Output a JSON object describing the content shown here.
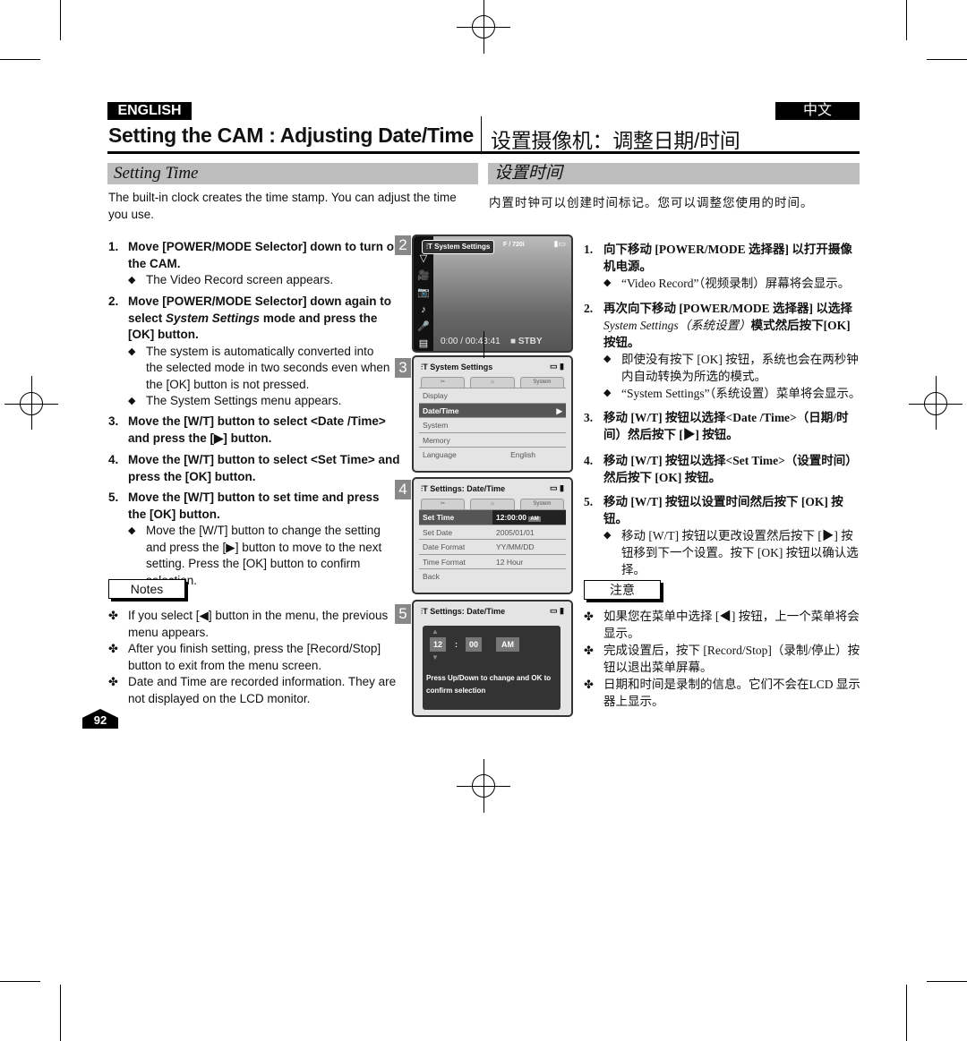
{
  "header": {
    "lang_en": "ENGLISH",
    "lang_cn": "中文",
    "title_en": "Setting the CAM : Adjusting Date/Time",
    "title_cn": "设置摄像机：调整日期/时间"
  },
  "section": {
    "title_en": "Setting Time",
    "title_cn": "设置时间"
  },
  "intro": {
    "en": "The built-in clock creates the time stamp. You can adjust the time you use.",
    "cn": "内置时钟可以创建时间标记。您可以调整您使用的时间。"
  },
  "steps_en": [
    {
      "num": "1.",
      "text": "Move [POWER/MODE Selector] down to turn on the CAM.",
      "bullets": [
        "The Video Record screen appears."
      ]
    },
    {
      "num": "2.",
      "text_a": "Move [POWER/MODE Selector] down again to select ",
      "text_i": "System Settings",
      "text_b": " mode and press the [OK] button.",
      "bullets": [
        "The system is automatically converted into the selected mode in two seconds even when the [OK] button is not pressed.",
        "The System Settings menu appears."
      ]
    },
    {
      "num": "3.",
      "text": "Move the [W/T] button to select <Date /Time> and press the [▶] button."
    },
    {
      "num": "4.",
      "text": "Move the [W/T] button to select <Set Time> and press the [OK] button."
    },
    {
      "num": "5.",
      "text": "Move the [W/T] button to set time and press the [OK] button.",
      "bullets": [
        "Move the [W/T] button to change the setting and press the [▶] button to move to the next setting. Press the [OK] button to confirm selection."
      ]
    }
  ],
  "notes_en": {
    "label": "Notes",
    "items": [
      "If you select [◀] button in the menu, the previous menu appears.",
      "After you finish setting, press the [Record/Stop] button to exit from the menu screen.",
      "Date and Time are recorded information. They are not displayed on the LCD monitor."
    ]
  },
  "steps_cn": [
    {
      "num": "1.",
      "text": "向下移动 [POWER/MODE 选择器] 以打开摄像机电源。",
      "bullets": [
        "“Video Record”（视频录制）屏幕将会显示。"
      ]
    },
    {
      "num": "2.",
      "text_a": "再次向下移动 [POWER/MODE 选择器] 以选择 ",
      "text_i": "System Settings（系统设置）",
      "text_b": "模式然后按下[OK] 按钮。",
      "bullets": [
        "即使没有按下 [OK] 按钮，系统也会在两秒钟内自动转换为所选的模式。",
        "“System Settings”（系统设置）菜单将会显示。"
      ]
    },
    {
      "num": "3.",
      "text": "移动 [W/T] 按钮以选择<Date /Time>（日期/时间）然后按下 [▶] 按钮。"
    },
    {
      "num": "4.",
      "text": "移动 [W/T] 按钮以选择<Set Time>（设置时间）然后按下 [OK] 按钮。"
    },
    {
      "num": "5.",
      "text": "移动 [W/T] 按钮以设置时间然后按下 [OK] 按钮。",
      "bullets": [
        "移动 [W/T] 按钮以更改设置然后按下 [▶] 按钮移到下一个设置。按下 [OK] 按钮以确认选择。"
      ]
    }
  ],
  "notes_cn": {
    "label": "注意",
    "items": [
      "如果您在菜单中选择 [◀] 按钮，上一个菜单将会显示。",
      "完成设置后，按下 [Record/Stop]（录制/停止）按钮以退出菜单屏幕。",
      "日期和时间是录制的信息。它们不会在LCD 显示器上显示。"
    ]
  },
  "screens": {
    "s2": {
      "num": "2",
      "menu": "System Settings",
      "quality": "F / 720i",
      "time": "0:00 / 00:43:41",
      "status": "STBY"
    },
    "s3": {
      "num": "3",
      "title": "System Settings",
      "tabs": [
        "✂",
        "⌂",
        "System"
      ],
      "rows": [
        {
          "label": "Display"
        },
        {
          "label": "Date/Time",
          "selected": true
        },
        {
          "label": "System"
        },
        {
          "label": "Memory"
        },
        {
          "label": "Language",
          "value": "English"
        }
      ]
    },
    "s4": {
      "num": "4",
      "title": "Settings: Date/Time",
      "tabs": [
        "✂",
        "⌂",
        "System"
      ],
      "rows": [
        {
          "label": "Set Time",
          "value": "12:00:00",
          "ampm": "AM",
          "selected": true
        },
        {
          "label": "Set Date",
          "value": "2005/01/01"
        },
        {
          "label": "Date Format",
          "value": "YY/MM/DD"
        },
        {
          "label": "Time Format",
          "value": "12 Hour"
        },
        {
          "label": "Back"
        }
      ]
    },
    "s5": {
      "num": "5",
      "title": "Settings: Date/Time",
      "hour": "12",
      "sep": ":",
      "minute": "00",
      "ampm": "AM",
      "hint": "Press Up/Down to change and OK to confirm selection"
    }
  },
  "page_number": "92"
}
